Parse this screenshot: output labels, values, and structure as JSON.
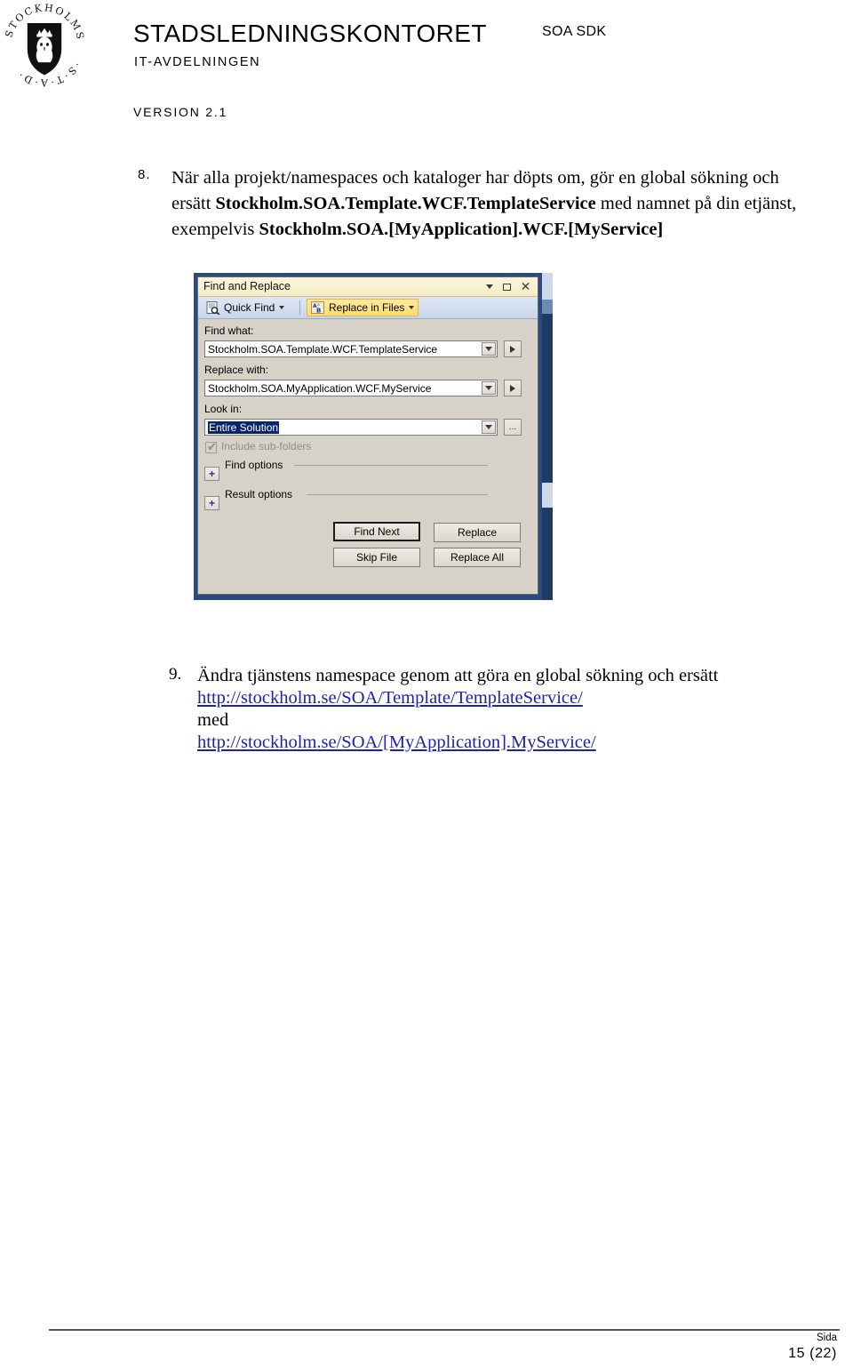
{
  "header": {
    "organization": "STADSLEDNINGSKONTORET",
    "department": "IT-AVDELNINGEN",
    "subject": "SOA SDK",
    "version": "VERSION 2.1",
    "logo_alt": "Stockholms Stad"
  },
  "items": {
    "item8": {
      "number": "8.",
      "line1_a": "När alla projekt/namespaces och kataloger har döpts om, gör en global sökning och ersätt ",
      "bold1": "Stockholm.SOA.Template.WCF.TemplateService",
      "line1_b": " med namnet på din etjänst, exempelvis ",
      "bold2": "Stockholm.SOA.[MyApplication].WCF.[MyService]"
    },
    "item9": {
      "number": "9.",
      "text_a": "Ändra tjänstens namespace genom att göra en global sökning och ersätt",
      "link1": "http://stockholm.se/SOA/Template/TemplateService/",
      "text_b": "med",
      "link2": "http://stockholm.se/SOA/[MyApplication].MyService/"
    }
  },
  "screenshot": {
    "dialog": {
      "title": "Find and Replace",
      "titlebar_buttons": {
        "dropdown": "chevron-down-icon",
        "maximize": "maximize-icon",
        "close": "×"
      },
      "toolbar": {
        "quick_find": "Quick Find",
        "replace_in_files": "Replace in Files"
      },
      "find_what": {
        "label": "Find what:",
        "value": "Stockholm.SOA.Template.WCF.TemplateService"
      },
      "replace_with": {
        "label": "Replace with:",
        "value": "Stockholm.SOA.MyApplication.WCF.MyService"
      },
      "look_in": {
        "label": "Look in:",
        "value": "Entire Solution",
        "browse_label": "..."
      },
      "include_subfolders": {
        "label": "Include sub-folders",
        "checked": true,
        "tick": "✔"
      },
      "find_options": {
        "label": "Find options",
        "expander": "+"
      },
      "result_options": {
        "label": "Result options",
        "expander": "+"
      },
      "buttons": {
        "find_next": "Find Next",
        "replace": "Replace",
        "skip_file": "Skip File",
        "replace_all": "Replace All"
      }
    },
    "colors": {
      "titlebar": "#f8efcf",
      "toolbar": "#cfdcee",
      "highlight": "#ffdc6e",
      "dialog_face": "#d6d2c8",
      "ide_backdrop": "#2b4b7d",
      "selection": "#0a246a"
    }
  },
  "footer": {
    "page_label": "Sida",
    "page_number": "15 (22)"
  }
}
